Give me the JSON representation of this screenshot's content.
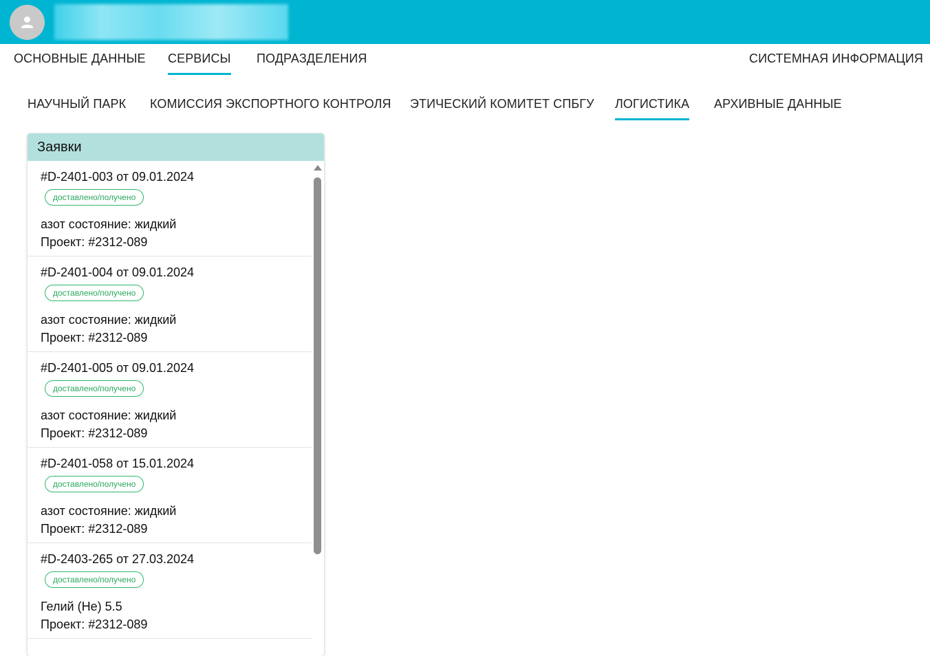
{
  "header": {
    "avatar_icon": "person-icon",
    "user_name": ""
  },
  "top_nav": {
    "tabs": [
      {
        "label": "ОСНОВНЫЕ ДАННЫЕ"
      },
      {
        "label": "СЕРВИСЫ"
      },
      {
        "label": "ПОДРАЗДЕЛЕНИЯ"
      },
      {
        "label": "СИСТЕМНАЯ ИНФОРМАЦИЯ"
      }
    ],
    "active": "СЕРВИСЫ"
  },
  "sub_nav": {
    "tabs": [
      {
        "label": "НАУЧНЫЙ ПАРК"
      },
      {
        "label": "КОМИССИЯ ЭКСПОРТНОГО КОНТРОЛЯ"
      },
      {
        "label": "ЭТИЧЕСКИЙ КОМИТЕТ СПБГУ"
      },
      {
        "label": "ЛОГИСТИКА"
      },
      {
        "label": "АРХИВНЫЕ ДАННЫЕ"
      }
    ],
    "active": "ЛОГИСТИКА"
  },
  "requests": {
    "title": "Заявки",
    "items": [
      {
        "title": "#D-2401-003 от 09.01.2024",
        "status": "доставлено/получено",
        "description": "азот состояние: жидкий",
        "project": "Проект: #2312-089"
      },
      {
        "title": "#D-2401-004 от 09.01.2024",
        "status": "доставлено/получено",
        "description": "азот состояние: жидкий",
        "project": "Проект: #2312-089"
      },
      {
        "title": "#D-2401-005 от 09.01.2024",
        "status": "доставлено/получено",
        "description": "азот состояние: жидкий",
        "project": "Проект: #2312-089"
      },
      {
        "title": "#D-2401-058 от 15.01.2024",
        "status": "доставлено/получено",
        "description": "азот состояние: жидкий",
        "project": "Проект: #2312-089"
      },
      {
        "title": "#D-2403-265 от 27.03.2024",
        "status": "доставлено/получено",
        "description": "Гелий (He) 5.5",
        "project": "Проект: #2312-089"
      }
    ]
  },
  "colors": {
    "header_bg": "#00b5d1",
    "accent": "#00b5d1",
    "panel_header_bg": "#b2e0dd",
    "status_green": "#2aa85f"
  }
}
